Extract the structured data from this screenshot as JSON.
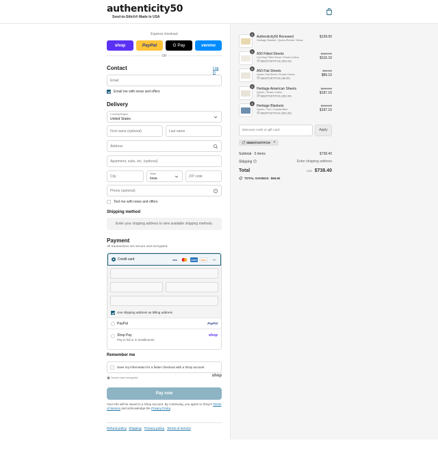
{
  "header": {
    "logo": "authenticity50",
    "tagline": "Seed-to-Stitch® Made in USA"
  },
  "express": {
    "title": "Express checkout",
    "buttons": {
      "shop": "shop",
      "paypal": "PayPal",
      "gpay": "G Pay",
      "venmo": "venmo"
    },
    "or": "OR"
  },
  "contact": {
    "title": "Contact",
    "login": "Log in",
    "email_placeholder": "Email",
    "email_news": "Email me with news and offers"
  },
  "delivery": {
    "title": "Delivery",
    "country_label": "Country/Region",
    "country_value": "United States",
    "first_name": "First name (optional)",
    "last_name": "Last name",
    "address": "Address",
    "apartment": "Apartment, suite, etc. (optional)",
    "city": "City",
    "state_label": "State",
    "state_value": "Iowa",
    "zip": "ZIP code",
    "phone": "Phone (optional)",
    "text_news": "Text me with news and offers"
  },
  "shipping": {
    "title": "Shipping method",
    "message": "Enter your shipping address to view available shipping methods."
  },
  "payment": {
    "title": "Payment",
    "subtitle": "All transactions are secure and encrypted.",
    "credit_card": "Credit card",
    "cards": [
      "VISA",
      "MC",
      "AMEX",
      "DISC"
    ],
    "more": "+3",
    "billing_same": "Use shipping address as billing address",
    "paypal_label": "PayPal",
    "paypal_logo": "PayPal",
    "shop_pay_label": "Shop Pay",
    "shop_pay_sub": "Pay in full or in installments",
    "shop_pay_logo": "shop"
  },
  "remember": {
    "title": "Remember me",
    "save_label": "Save my information for a faster checkout with a Shop account",
    "secure": "Secure and encrypted",
    "shop_logo": "shop"
  },
  "pay_now": "Pay now",
  "fine_print": {
    "line1": "Your info will be saved to a Shop account. By continuing, you agree to Shop's",
    "terms": "Terms of Service",
    "and": "and acknowledge the",
    "privacy": "Privacy Policy",
    "end": "."
  },
  "footer": [
    "Refund policy",
    "Shipping",
    "Privacy policy",
    "Terms of service"
  ],
  "summary": {
    "items": [
      {
        "qty": "1",
        "name": "Authenticity50 Renewed",
        "variant": "Heritage Blanket / Queen/Primier Yellow",
        "discount": "",
        "old_price": "",
        "price": "$139.00",
        "color": "#e9d9b0"
      },
      {
        "qty": "1",
        "name": "A50 Fitted Sheets",
        "variant": "Cal King Fitted Sheet / Rustic Cotton",
        "discount": "SEEDTOSTITCH (-$12.00)",
        "old_price": "$128.00",
        "price": "$116.10",
        "color": "#efeae2"
      },
      {
        "qty": "1",
        "name": "A50 Flat Sheets",
        "variant": "Queen Flat Sheet / Rustic Cotton",
        "discount": "SEEDTOSTITCH (-$9.90)",
        "old_price": "$99.00",
        "price": "$89.10",
        "color": "#ebe6dd"
      },
      {
        "qty": "1",
        "name": "Heritage American Sheets",
        "variant": "Queen / Rustic Cotton",
        "discount": "SEEDTOSTITCH (-$21.90)",
        "old_price": "$219.00",
        "price": "$197.10",
        "color": "#e8e2d8"
      },
      {
        "qty": "1",
        "name": "Heritage Blankets",
        "variant": "Queen / Full / Coastal Blue",
        "discount": "SEEDTOSTITCH (-$21.90)",
        "old_price": "$219.00",
        "price": "$197.10",
        "color": "#6f8fae"
      }
    ],
    "discount_placeholder": "Discount code or gift card",
    "apply": "Apply",
    "applied_code": "SEEDTOSTITCH",
    "subtotal_label": "Subtotal · 5 items",
    "subtotal_value": "$738.40",
    "shipping_label": "Shipping",
    "shipping_value": "Enter shipping address",
    "total_label": "Total",
    "currency": "USD",
    "total_value": "$738.40",
    "savings_label": "TOTAL SAVINGS",
    "savings_value": "$66.60"
  }
}
